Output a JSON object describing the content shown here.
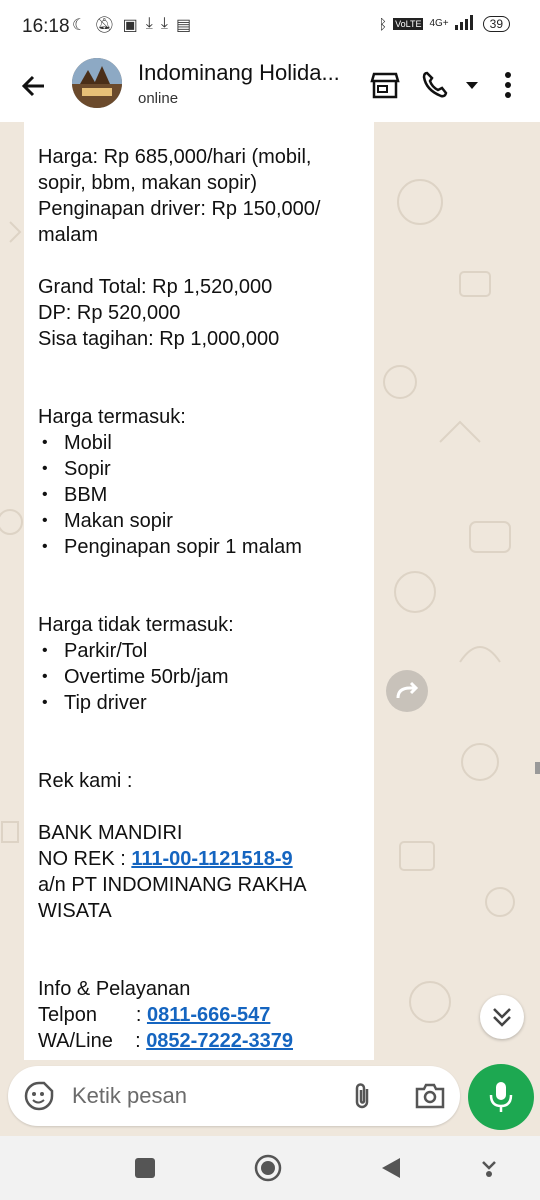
{
  "status_bar": {
    "time": "16:18",
    "network": "4G+",
    "battery": "39"
  },
  "header": {
    "title": "Indominang Holida...",
    "subtitle": "online"
  },
  "message": {
    "lines": [
      {
        "text": "Harga: Rp 685,000/hari (mobil,",
        "type": "text"
      },
      {
        "text": "sopir, bbm, makan sopir)",
        "type": "text"
      },
      {
        "text": "Penginapan driver: Rp 150,000/",
        "type": "text"
      },
      {
        "text": "malam",
        "type": "text"
      },
      {
        "text": "",
        "type": "blank"
      },
      {
        "text": "Grand Total: Rp 1,520,000",
        "type": "text"
      },
      {
        "text": "DP: Rp 520,000",
        "type": "text"
      },
      {
        "text": "Sisa tagihan: Rp 1,000,000",
        "type": "text"
      },
      {
        "text": "",
        "type": "blank"
      },
      {
        "text": "",
        "type": "blank"
      },
      {
        "text": "Harga termasuk:",
        "type": "text"
      },
      {
        "text": "Mobil",
        "type": "bullet"
      },
      {
        "text": "Sopir",
        "type": "bullet"
      },
      {
        "text": "BBM",
        "type": "bullet"
      },
      {
        "text": "Makan sopir",
        "type": "bullet"
      },
      {
        "text": "Penginapan sopir 1 malam",
        "type": "bullet"
      },
      {
        "text": "",
        "type": "blank"
      },
      {
        "text": "",
        "type": "blank"
      },
      {
        "text": "Harga tidak termasuk:",
        "type": "text"
      },
      {
        "text": "Parkir/Tol",
        "type": "bullet"
      },
      {
        "text": "Overtime 50rb/jam",
        "type": "bullet"
      },
      {
        "text": "Tip driver",
        "type": "bullet"
      },
      {
        "text": "",
        "type": "blank"
      },
      {
        "text": "",
        "type": "blank"
      },
      {
        "text": "Rek kami :",
        "type": "text"
      },
      {
        "text": "",
        "type": "blank"
      },
      {
        "text": "BANK MANDIRI",
        "type": "text"
      },
      {
        "text": "NO REK : ",
        "type": "link",
        "link": "111-00-1121518-9"
      },
      {
        "text": "a/n PT INDOMINANG RAKHA",
        "type": "text"
      },
      {
        "text": "WISATA",
        "type": "text"
      },
      {
        "text": "",
        "type": "blank"
      },
      {
        "text": "",
        "type": "blank"
      },
      {
        "text": "Info & Pelayanan",
        "type": "text"
      },
      {
        "text": "Telpon       : ",
        "type": "link",
        "link": "0811-666-547"
      },
      {
        "text": "WA/Line    : ",
        "type": "link",
        "link": "0852-7222-3379"
      }
    ]
  },
  "composer": {
    "placeholder": "Ketik pesan"
  },
  "colors": {
    "accent_green": "#1da851",
    "link_blue": "#1565c0",
    "wallpaper": "#efe7dc"
  }
}
